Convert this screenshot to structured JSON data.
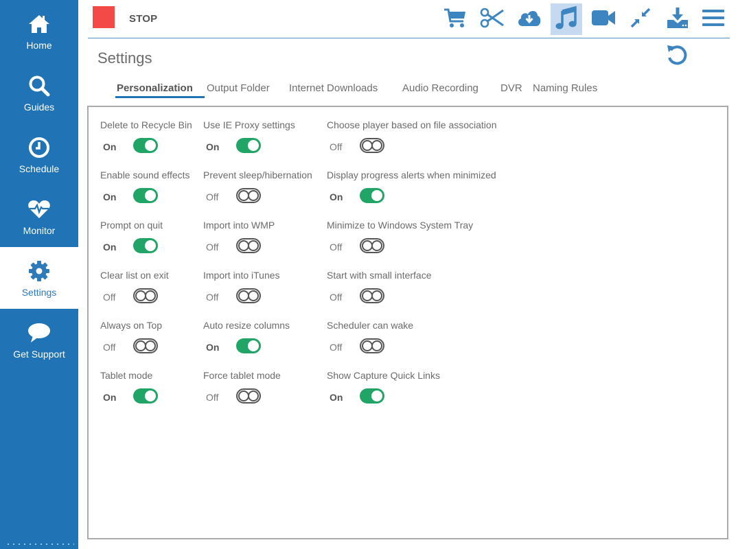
{
  "sidebar": {
    "items": [
      {
        "label": "Home",
        "icon": "home-icon",
        "active": false
      },
      {
        "label": "Guides",
        "icon": "search-icon",
        "active": false
      },
      {
        "label": "Schedule",
        "icon": "clock-icon",
        "active": false
      },
      {
        "label": "Monitor",
        "icon": "heartbeat-icon",
        "active": false
      },
      {
        "label": "Settings",
        "icon": "gear-icon",
        "active": true
      },
      {
        "label": "Get Support",
        "icon": "chat-bubble-icon",
        "active": false
      }
    ]
  },
  "topbar": {
    "stop_label": "STOP",
    "stop_color": "#f44a47",
    "tools": [
      {
        "name": "cart-icon",
        "active": false
      },
      {
        "name": "scissors-icon",
        "active": false
      },
      {
        "name": "cloud-download-icon",
        "active": false
      },
      {
        "name": "music-note-icon",
        "active": true
      },
      {
        "name": "video-camera-icon",
        "active": false
      },
      {
        "name": "compress-icon",
        "active": false
      },
      {
        "name": "download-tray-icon",
        "active": false
      },
      {
        "name": "hamburger-menu-icon",
        "active": false
      }
    ]
  },
  "page": {
    "title": "Settings",
    "reset_icon": "reset-icon"
  },
  "tabs": [
    {
      "label": "Personalization",
      "active": true
    },
    {
      "label": "Output Folder",
      "active": false
    },
    {
      "label": "Internet Downloads",
      "active": false
    },
    {
      "label": "Audio Recording",
      "active": false
    },
    {
      "label": "DVR",
      "active": false
    },
    {
      "label": "Naming Rules",
      "active": false
    }
  ],
  "settings": {
    "columns": [
      [
        {
          "label": "Delete to Recycle Bin",
          "state": "On"
        },
        {
          "label": "Enable sound effects",
          "state": "On"
        },
        {
          "label": "Prompt on quit",
          "state": "On"
        },
        {
          "label": "Clear list on exit",
          "state": "Off"
        },
        {
          "label": "Always on Top",
          "state": "Off"
        },
        {
          "label": "Tablet mode",
          "state": "On"
        }
      ],
      [
        {
          "label": "Use IE Proxy settings",
          "state": "On"
        },
        {
          "label": "Prevent sleep/hibernation",
          "state": "Off"
        },
        {
          "label": "Import into WMP",
          "state": "Off"
        },
        {
          "label": "Import into iTunes",
          "state": "Off"
        },
        {
          "label": "Auto resize columns",
          "state": "On"
        },
        {
          "label": "Force tablet mode",
          "state": "Off"
        }
      ],
      [
        {
          "label": "Choose player based on file association",
          "state": "Off"
        },
        {
          "label": "Display progress alerts when minimized",
          "state": "On"
        },
        {
          "label": "Minimize to Windows System Tray",
          "state": "Off"
        },
        {
          "label": "Start with small interface",
          "state": "Off"
        },
        {
          "label": "Scheduler can wake",
          "state": "Off"
        },
        {
          "label": "Show Capture Quick Links",
          "state": "On"
        }
      ]
    ]
  },
  "colors": {
    "sidebar": "#2073b4",
    "accent": "#2073b4",
    "icon": "#3d85c0",
    "toggle_on": "#21a567",
    "active_tool_bg": "#c5d9f0"
  }
}
